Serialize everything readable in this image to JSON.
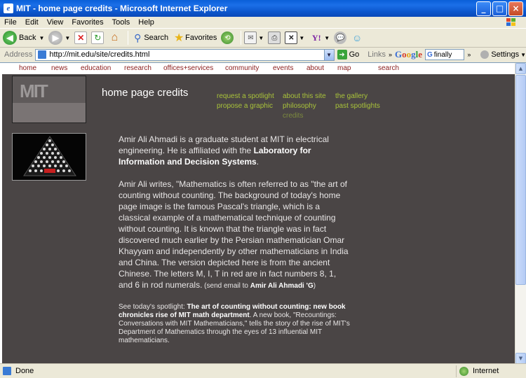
{
  "window": {
    "title": "MIT - home page credits - Microsoft Internet Explorer",
    "controls": {
      "minimize": "_",
      "maximize": "□",
      "close": "×"
    }
  },
  "menu": [
    "File",
    "Edit",
    "View",
    "Favorites",
    "Tools",
    "Help"
  ],
  "toolbar": {
    "back": "Back",
    "search": "Search",
    "favorites": "Favorites"
  },
  "address": {
    "label": "Address",
    "url": "http://mit.edu/site/credits.html",
    "go": "Go",
    "links": "Links",
    "google_search_value": "finally",
    "settings": "Settings"
  },
  "site_nav": [
    "home",
    "news",
    "education",
    "research",
    "offices+services",
    "community",
    "events",
    "about",
    "map",
    "search"
  ],
  "logo": {
    "text": "MIT"
  },
  "page": {
    "title": "home page credits",
    "links_col1": [
      "request a spotlight",
      "propose a graphic"
    ],
    "links_col2": [
      "about this site",
      "philosophy",
      "credits"
    ],
    "links_col3": [
      "the gallery",
      "past spotlights"
    ]
  },
  "content": {
    "p1_a": "Amir Ali Ahmadi is a graduate student at MIT in electrical engineering. He is affiliated with the ",
    "p1_b": "Laboratory for Information and Decision Systems",
    "p1_c": ".",
    "p2_a": "Amir Ali writes, \"Mathematics is often referred to as \"the art of counting without counting. The background of today's home page image is the famous Pascal's triangle, which is a classical example of a mathematical technique of counting without counting. It is known that the triangle was in fact discovered much earlier by the Persian mathematician Omar Khayyam and independently by other mathematicians in India and China. The version depicted here is from the ancient Chinese. The letters M, I, T in red are in fact numbers 8, 1, and 6 in rod numerals.",
    "p2_small_a": " (send email to ",
    "p2_small_b": "Amir Ali Ahmadi 'G",
    "p2_small_c": ")",
    "p3_a": "See today's spotlight: ",
    "p3_b": "The art of counting without counting: new book chronicles rise of MIT math department",
    "p3_c": ". A new book, \"Recountings: Conversations with MIT Mathematicians,\" tells the story of the rise of MIT's Department of Mathematics through the eyes of 13 influential MIT mathematicians."
  },
  "status": {
    "text": "Done",
    "zone": "Internet"
  }
}
